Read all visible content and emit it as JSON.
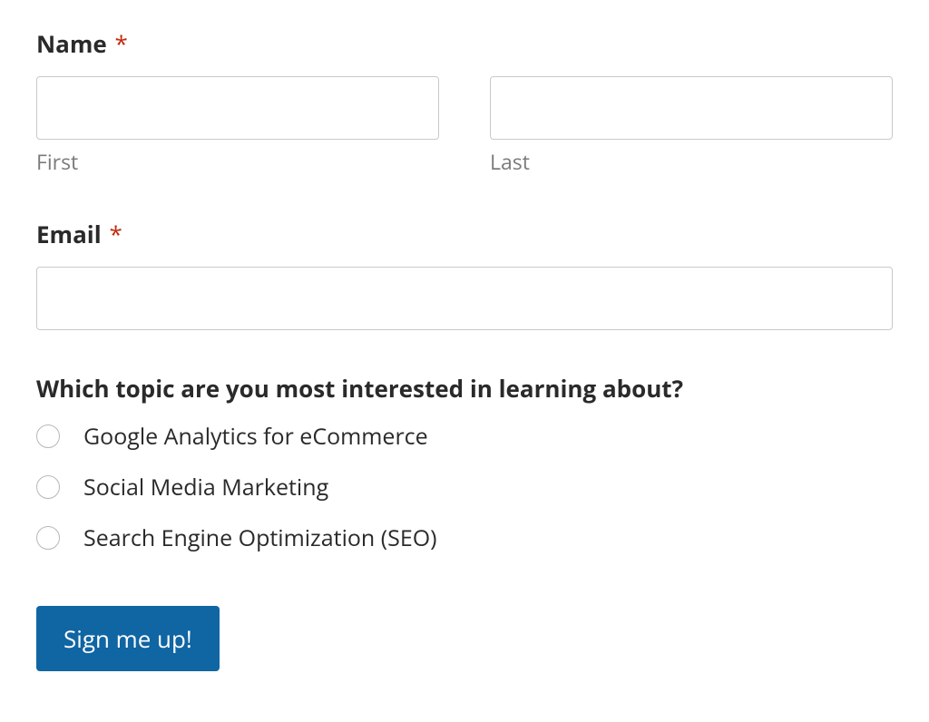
{
  "name": {
    "label": "Name",
    "required_mark": "*",
    "first_value": "",
    "first_sublabel": "First",
    "last_value": "",
    "last_sublabel": "Last"
  },
  "email": {
    "label": "Email",
    "required_mark": "*",
    "value": ""
  },
  "topic": {
    "question": "Which topic are you most interested in learning about?",
    "options": [
      "Google Analytics for eCommerce",
      "Social Media Marketing",
      "Search Engine Optimization (SEO)"
    ]
  },
  "submit": {
    "label": "Sign me up!"
  }
}
